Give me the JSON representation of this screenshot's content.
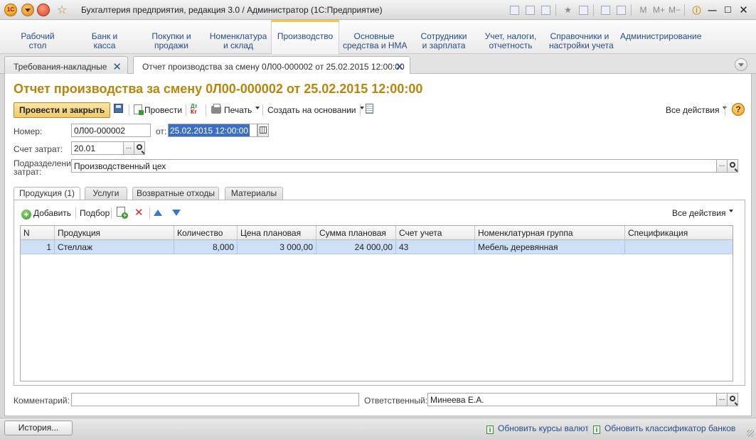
{
  "window": {
    "title": "Бухгалтерия предприятия, редакция 3.0 / Администратор  (1С:Предприятие)",
    "logo_text": "1С",
    "icons": [
      "save-icon",
      "print-icon",
      "preview-icon",
      "favorites-icon",
      "history-icon",
      "calculator-icon",
      "calendar-icon",
      "m-memory-icon",
      "m-plus-icon",
      "m-minus-icon",
      "info-icon",
      "minimize-icon",
      "maximize-icon",
      "close-icon"
    ],
    "memory_labels": [
      "M",
      "M+",
      "M−"
    ],
    "controls": {
      "minimize": "—",
      "maximize": "☐",
      "close": "✕"
    }
  },
  "sections": [
    {
      "label_1": "Рабочий",
      "label_2": "стол"
    },
    {
      "label_1": "Банк и",
      "label_2": "касса"
    },
    {
      "label_1": "Покупки и",
      "label_2": "продажи"
    },
    {
      "label_1": "Номенклатура",
      "label_2": "и склад"
    },
    {
      "label_1": "Производство",
      "label_2": ""
    },
    {
      "label_1": "Основные",
      "label_2": "средства и НМА"
    },
    {
      "label_1": "Сотрудники",
      "label_2": "и зарплата"
    },
    {
      "label_1": "Учет, налоги,",
      "label_2": "отчетность"
    },
    {
      "label_1": "Справочники и",
      "label_2": "настройки учета"
    },
    {
      "label_1": "Администрирование",
      "label_2": ""
    }
  ],
  "active_section": "Производство",
  "open_windows": [
    {
      "label": "Требования-накладные",
      "close": "✕"
    },
    {
      "label": "Отчет производства за смену 0Л00-000002 от 25.02.2015 12:00:00",
      "close": "✕"
    }
  ],
  "document": {
    "title": "Отчет производства за смену 0Л00-000002 от 25.02.2015 12:00:00",
    "toolbar": {
      "post_and_close": "Провести и закрыть",
      "post": "Провести",
      "dt_kt_top": "Дт",
      "dt_kt_bottom": "Кт",
      "print": "Печать",
      "create_based_on": "Создать на основании",
      "all_actions": "Все действия",
      "help": "?"
    },
    "fields": {
      "number_label": "Номер:",
      "number_value": "0Л00-000002",
      "date_label": "от:",
      "date_value": "25.02.2015 12:00:00",
      "cost_account_label": "Счет затрат:",
      "cost_account_value": "20.01",
      "department_label_1": "Подразделение",
      "department_label_2": "затрат:",
      "department_value": "Производственный цех",
      "comment_label": "Комментарий:",
      "comment_value": "",
      "responsible_label": "Ответственный:",
      "responsible_value": "Минеева Е.А.",
      "choice_button": "..."
    },
    "tabs": [
      "Продукция (1)",
      "Услуги",
      "Возвратные отходы",
      "Материалы"
    ],
    "products_toolbar": {
      "add": "Добавить",
      "add_icon_text": "+",
      "pick": "Подбор",
      "delete_icon_text": "✕",
      "all_actions": "Все действия"
    },
    "table": {
      "columns": [
        "N",
        "Продукция",
        "Количество",
        "Цена плановая",
        "Сумма плановая",
        "Счет учета",
        "Номенклатурная группа",
        "Спецификация"
      ],
      "rows": [
        {
          "n": "1",
          "product": "Стеллаж",
          "qty": "8,000",
          "price": "3 000,00",
          "sum": "24 000,00",
          "account": "43",
          "group": "Мебель деревянная",
          "spec": ""
        }
      ]
    }
  },
  "statusbar": {
    "history": "История...",
    "link_rates": "Обновить курсы валют",
    "link_banks": "Обновить классификатор банков",
    "info_icon_text": "i"
  }
}
